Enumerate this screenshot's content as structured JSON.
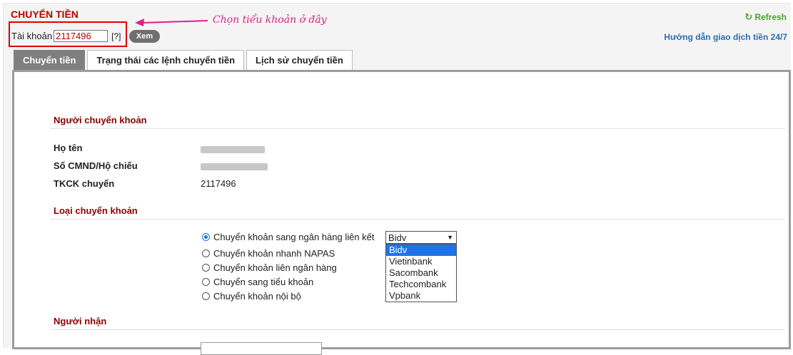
{
  "header": {
    "title": "CHUYỂN TIỀN",
    "account_label": "Tài khoản",
    "account_value": "2117496",
    "help_label": "[?]",
    "view_button": "Xem",
    "refresh_label": "Refresh",
    "guide_link": "Hướng dẫn giao dịch tiền 24/7"
  },
  "annotation": {
    "text": "Chọn tiểu khoản ở đây",
    "color": "#e0208a"
  },
  "tabs": [
    {
      "label": "Chuyển tiền",
      "active": true
    },
    {
      "label": "Trạng thái các lệnh chuyển tiền",
      "active": false
    },
    {
      "label": "Lịch sử chuyển tiền",
      "active": false
    }
  ],
  "sender": {
    "section_title": "Người chuyển khoản",
    "name_label": "Họ tên",
    "id_label": "Số CMND/Hộ chiếu",
    "account_label": "TKCK chuyển",
    "account_value": "2117496"
  },
  "transfer_type": {
    "section_title": "Loại chuyển khoản",
    "options": [
      {
        "label": "Chuyển khoản sang ngân hàng liên kết",
        "checked": true
      },
      {
        "label": "Chuyển khoản nhanh NAPAS",
        "checked": false
      },
      {
        "label": "Chuyển khoản liên ngân hàng",
        "checked": false
      },
      {
        "label": "Chuyển sang tiểu khoản",
        "checked": false
      },
      {
        "label": "Chuyển khoản nội bộ",
        "checked": false
      }
    ],
    "bank_selected": "Bidv",
    "bank_options": [
      "Bidv",
      "Vietinbank",
      "Sacombank",
      "Techcombank",
      "Vpbank"
    ]
  },
  "receiver": {
    "section_title": "Người nhận"
  },
  "colors": {
    "title_red": "#c00000",
    "section_red": "#8b0000",
    "refresh_green": "#4aa32a",
    "link_blue": "#2a6fb0",
    "select_blue": "#1e73e8"
  }
}
